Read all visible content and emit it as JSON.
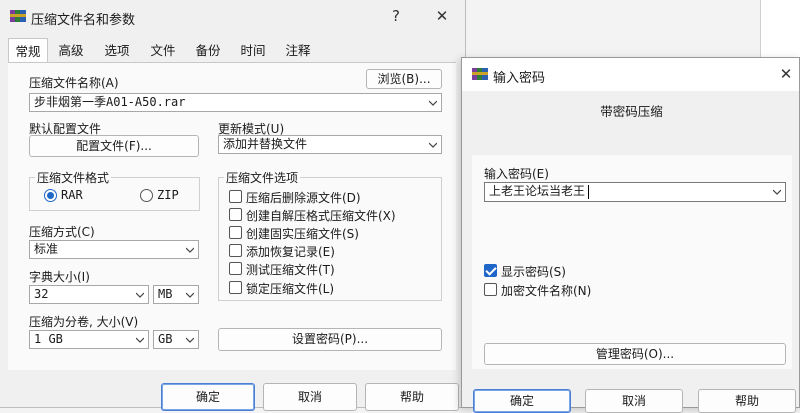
{
  "main_window": {
    "title": "压缩文件名和参数",
    "help_glyph": "?",
    "close_glyph": "✕",
    "tabs": [
      "常规",
      "高级",
      "选项",
      "文件",
      "备份",
      "时间",
      "注释"
    ],
    "archive_name_label": "压缩文件名称(A)",
    "browse_button": "浏览(B)...",
    "archive_name_value": "步非烟第一季A01-A50.rar",
    "default_profile_label": "默认配置文件",
    "profiles_button": "配置文件(F)...",
    "update_mode_label": "更新模式(U)",
    "update_mode_value": "添加并替换文件",
    "format_group_title": "压缩文件格式",
    "format_rar": "RAR",
    "format_zip": "ZIP",
    "options_group_title": "压缩文件选项",
    "options": [
      "压缩后删除源文件(D)",
      "创建自解压格式压缩文件(X)",
      "创建固实压缩文件(S)",
      "添加恢复记录(E)",
      "测试压缩文件(T)",
      "锁定压缩文件(L)"
    ],
    "method_label": "压缩方式(C)",
    "method_value": "标准",
    "dict_label": "字典大小(I)",
    "dict_value": "32",
    "dict_unit": "MB",
    "split_label": "压缩为分卷, 大小(V)",
    "split_value": "1 GB",
    "split_unit": "GB",
    "set_password_button": "设置密码(P)...",
    "ok_button": "确定",
    "cancel_button": "取消",
    "help_button": "帮助"
  },
  "password_dialog": {
    "title": "输入密码",
    "close_glyph": "✕",
    "subtitle": "带密码压缩",
    "password_label": "输入密码(E)",
    "password_value": "上老王论坛当老王",
    "show_password": "显示密码(S)",
    "encrypt_names": "加密文件名称(N)",
    "manage_button": "管理密码(O)...",
    "ok_button": "确定",
    "cancel_button": "取消",
    "help_button": "帮助"
  },
  "colors": {
    "accent": "#1e66c8",
    "window_bg": "#f0f0f0",
    "panel_bg": "#fafafa"
  }
}
